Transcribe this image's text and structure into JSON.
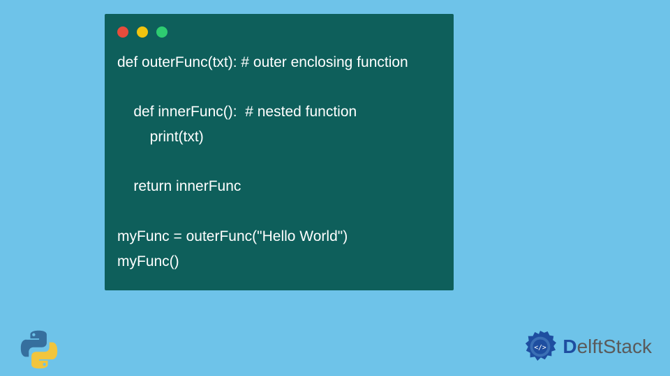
{
  "code": {
    "line1": "def outerFunc(txt): # outer enclosing function",
    "line2": "",
    "line3": "    def innerFunc():  # nested function",
    "line4": "        print(txt)",
    "line5": "",
    "line6": "    return innerFunc",
    "line7": "",
    "line8": "myFunc = outerFunc(\"Hello World\")",
    "line9": "myFunc()"
  },
  "brand": {
    "prefix": "D",
    "rest": "elftStack"
  },
  "colors": {
    "bg": "#6ec3e9",
    "block": "#0e5f5b",
    "red": "#e74c3c",
    "yellow": "#f1c40f",
    "green": "#2ecc71",
    "brand_primary": "#1e4ea0",
    "brand_secondary": "#5a5a5a"
  },
  "icons": {
    "python": "python-logo",
    "brand_badge": "delft-gear-badge"
  }
}
